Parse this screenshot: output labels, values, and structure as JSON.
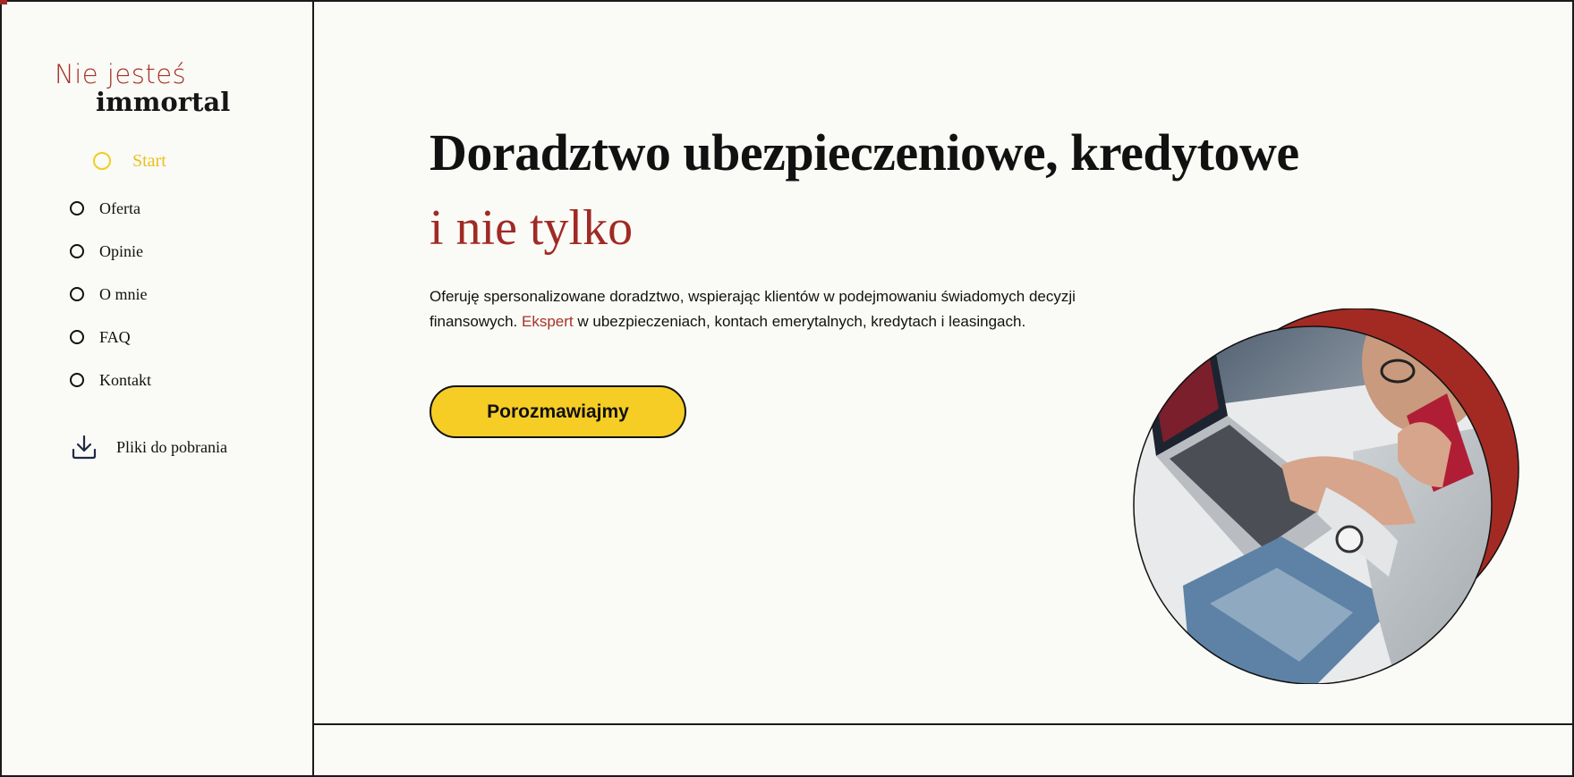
{
  "brand": {
    "line1": "Nie jesteś",
    "line2": "immortal",
    "accent_color": "#a83228"
  },
  "nav": {
    "items": [
      {
        "label": "Start",
        "active": true
      },
      {
        "label": "Oferta",
        "active": false
      },
      {
        "label": "Opinie",
        "active": false
      },
      {
        "label": "O mnie",
        "active": false
      },
      {
        "label": "FAQ",
        "active": false
      },
      {
        "label": "Kontakt",
        "active": false
      }
    ],
    "active_color": "#f2cd21"
  },
  "downloads": {
    "label": "Pliki do pobrania",
    "icon": "download-icon"
  },
  "hero": {
    "title": "Doradztwo ubezpieczeniowe, kredytowe",
    "title_accent": "i nie tylko",
    "intro_part1": "Oferuję spersonalizowane doradztwo, wspierając klientów w podejmowaniu świadomych decyzji finansowych. ",
    "intro_accent": "Ekspert",
    "intro_part2": " w ubezpieczeniach, kontach emerytalnych, kredytach i leasingach.",
    "cta_label": "Porozmawiajmy",
    "cta_color": "#f5cd25",
    "image_alt": "man-on-phone-at-laptop-photo"
  }
}
